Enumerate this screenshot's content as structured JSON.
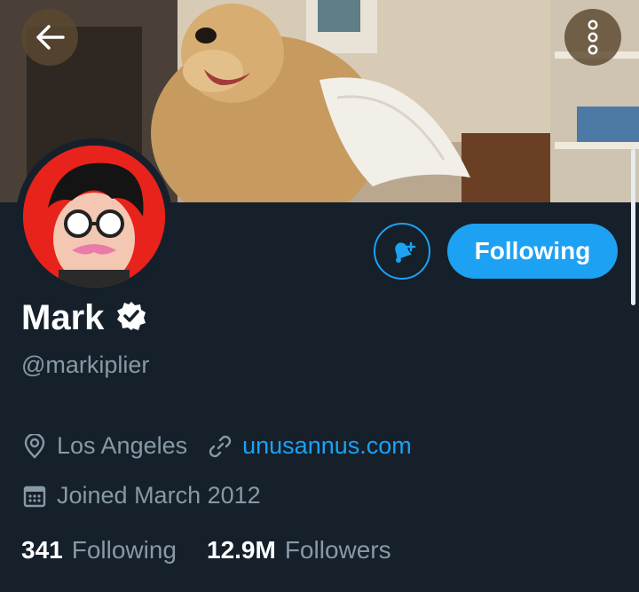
{
  "header": {
    "back_icon": "arrow-left-icon",
    "more_icon": "more-vertical-icon"
  },
  "profile": {
    "name": "Mark",
    "verified": true,
    "handle": "@markiplier",
    "location": "Los Angeles",
    "website": "unusannus.com",
    "joined": "Joined March 2012",
    "following_count": "341",
    "following_label": "Following",
    "followers_count": "12.9M",
    "followers_label": "Followers"
  },
  "actions": {
    "follow_state_label": "Following",
    "notifications_icon": "bell-plus-icon"
  },
  "colors": {
    "background": "#15202b",
    "accent": "#1da1f2",
    "muted_text": "#8899a6",
    "primary_text": "#ffffff"
  }
}
